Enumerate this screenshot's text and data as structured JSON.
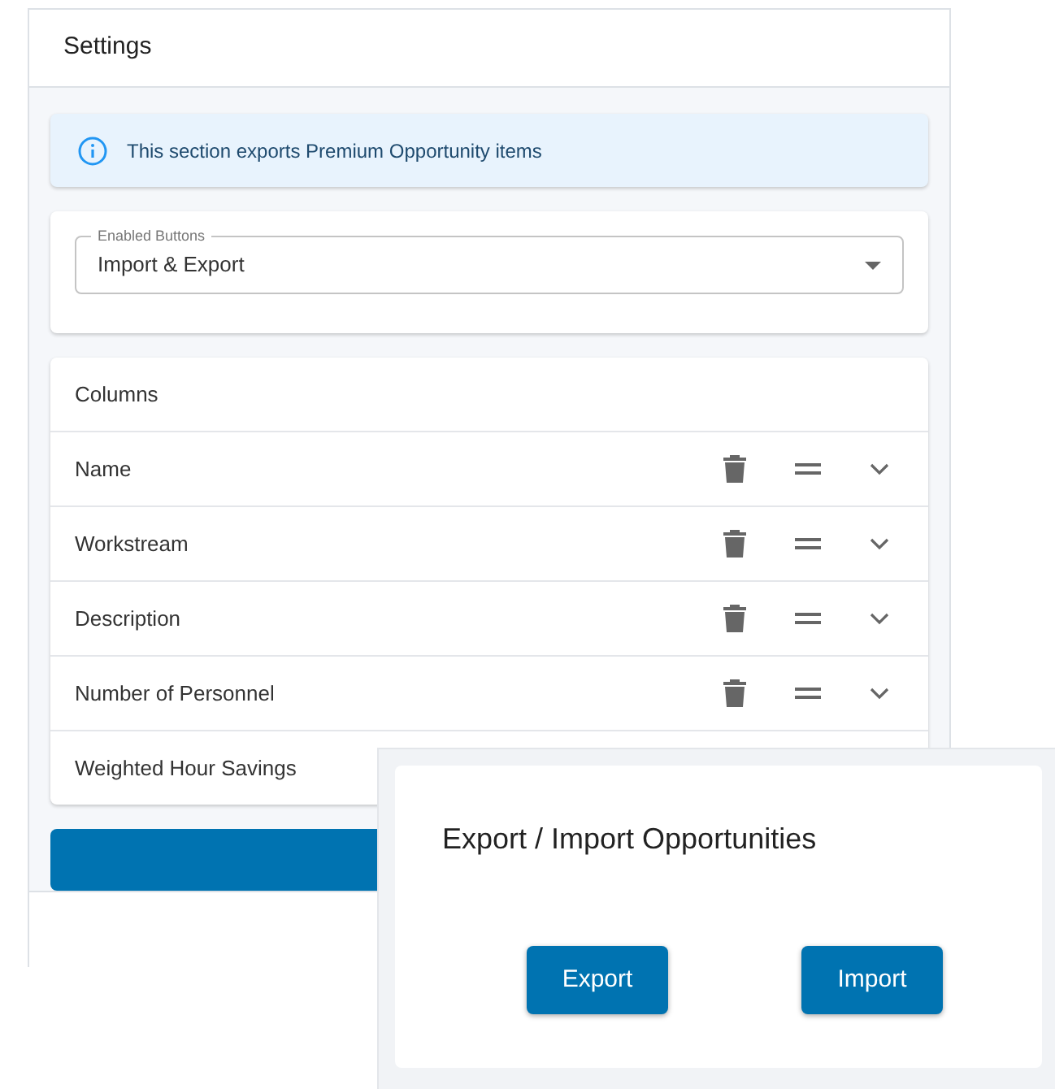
{
  "settings": {
    "title": "Settings",
    "info": "This section exports Premium Opportunity items",
    "select": {
      "label": "Enabled Buttons",
      "value": "Import & Export"
    },
    "columns": {
      "title": "Columns",
      "rows": [
        {
          "name": "Name"
        },
        {
          "name": "Workstream"
        },
        {
          "name": "Description"
        },
        {
          "name": "Number of Personnel"
        },
        {
          "name": "Weighted Hour Savings"
        }
      ]
    }
  },
  "dialog": {
    "title": "Export / Import Opportunities",
    "buttons": [
      "Export",
      "Import"
    ]
  }
}
